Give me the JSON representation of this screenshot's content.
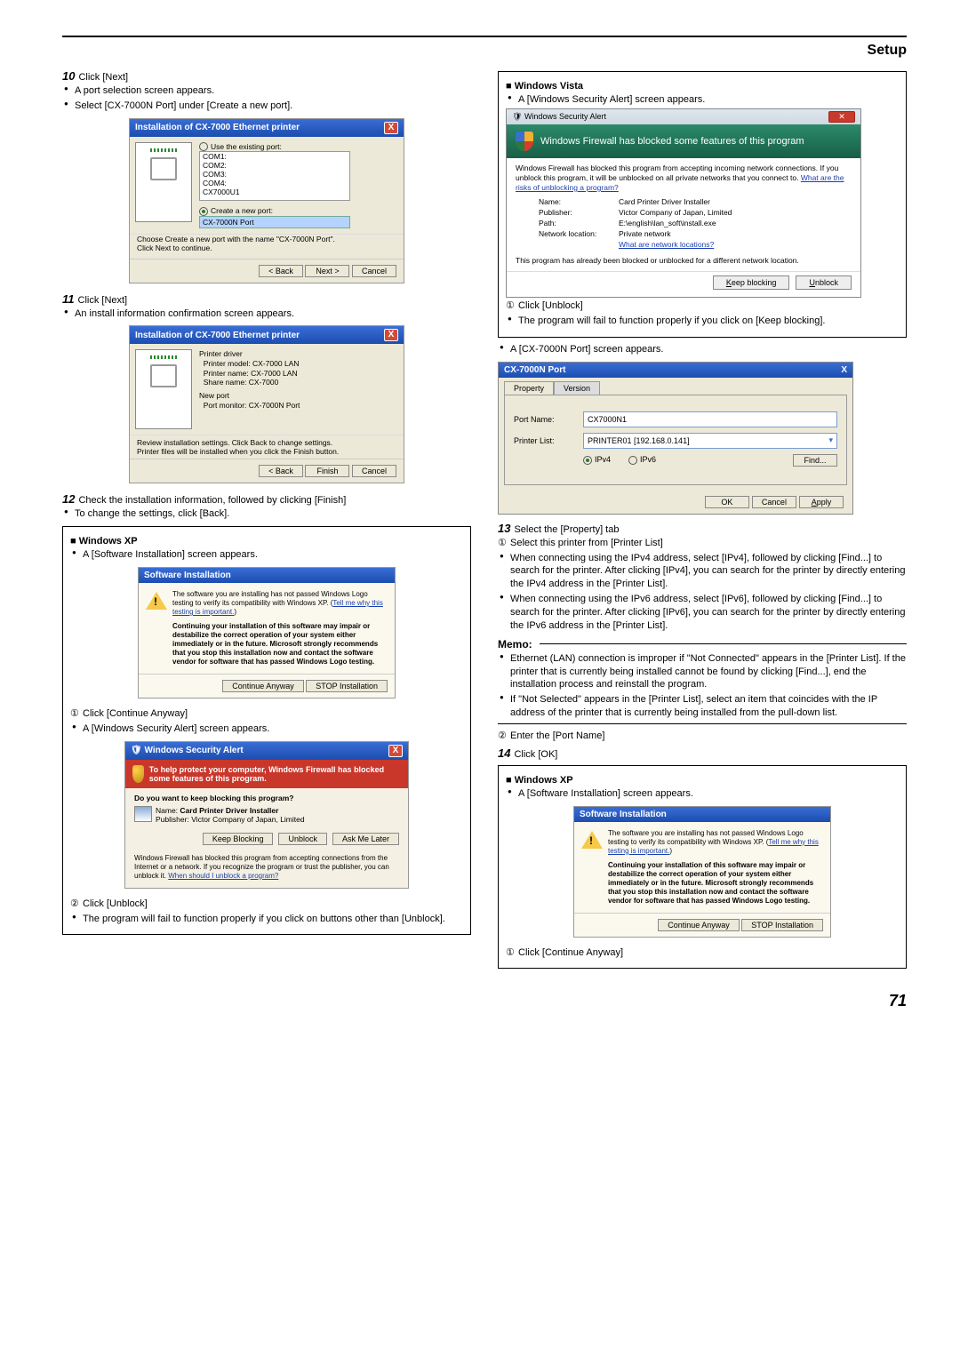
{
  "header": {
    "title": "Setup"
  },
  "page_number": "71",
  "steps": {
    "s10": {
      "num": "10",
      "text": "Click [Next]",
      "b1": "A port selection screen appears.",
      "b2": "Select [CX-7000N Port] under [Create a new port]."
    },
    "s11": {
      "num": "11",
      "text": "Click [Next]",
      "b1": "An install information confirmation screen appears."
    },
    "s12": {
      "num": "12",
      "text": "Check the installation information, followed by clicking [Finish]",
      "b1": "To change the settings, click [Back]."
    },
    "s13": {
      "num": "13",
      "text": "Select the [Property] tab"
    },
    "s14": {
      "num": "14",
      "text": "Click [OK]"
    }
  },
  "xp1": {
    "head": "Windows XP",
    "b1": "A [Software Installation] screen appears.",
    "c1": "Click [Continue Anyway]",
    "b2": "A [Windows Security Alert] screen appears.",
    "c2": "Click [Unblock]",
    "b3": "The program will fail to function properly if you click on buttons other than [Unblock]."
  },
  "vista": {
    "head": "Windows Vista",
    "b1": "A [Windows Security Alert] screen appears.",
    "c1": "Click [Unblock]",
    "b2": "The program will fail to function properly if you click on [Keep blocking].",
    "b3": "A [CX-7000N Port] screen appears."
  },
  "prop": {
    "c1": "Select this printer from [Printer List]",
    "b1": "When connecting using the IPv4 address, select [IPv4], followed by clicking [Find...] to search for the printer. After clicking [IPv4], you can search for the printer by directly entering the IPv4 address in the [Printer List].",
    "b2": "When connecting using the IPv6 address, select [IPv6], followed by clicking [Find...] to search for the printer. After clicking [IPv6], you can search for the printer by directly entering the IPv6 address in the [Printer List].",
    "memo_label": "Memo:",
    "m1": "Ethernet (LAN) connection is improper if \"Not Connected\" appears in the [Printer List]. If the printer that is currently being installed cannot be found by clicking [Find...], end the installation process and reinstall the program.",
    "m2": "If \"Not Selected\" appears in the [Printer List], select an item that coincides with the IP address of the printer that is currently being installed from the pull-down list.",
    "c2": "Enter the [Port Name]"
  },
  "xp2": {
    "head": "Windows XP",
    "b1": "A [Software Installation] screen appears.",
    "c1": "Click [Continue Anyway]"
  },
  "dlg1": {
    "title": "Installation of CX-7000 Ethernet printer",
    "use_existing": "Use the existing port:",
    "ports": "COM1:\nCOM2:\nCOM3:\nCOM4:\nCX7000U1",
    "create_new": "Create a new port:",
    "new_port_value": "CX-7000N Port",
    "instr": "Choose Create a new port with the name \"CX-7000N Port\".\nClick Next to continue.",
    "back": "< Back",
    "next": "Next >",
    "cancel": "Cancel"
  },
  "dlg2": {
    "title": "Installation of CX-7000 Ethernet printer",
    "pd": "Printer driver",
    "pm": "Printer model:",
    "pm_v": "CX-7000 LAN",
    "pn": "Printer name:",
    "pn_v": "CX-7000 LAN",
    "sn": "Share name:",
    "sn_v": "CX-7000",
    "np": "New port",
    "pmon": "Port monitor:",
    "pmon_v": "CX-7000N Port",
    "review": "Review installation settings. Click Back to change settings.\nPrinter files will be installed when you click the Finish button.",
    "back": "< Back",
    "finish": "Finish",
    "cancel": "Cancel"
  },
  "dlg3": {
    "title": "Software Installation",
    "l1": "The software you are installing has not passed Windows Logo testing to verify its compatibility with Windows XP. (",
    "link1": "Tell me why this testing is important.",
    "l1b": ")",
    "l2": "Continuing your installation of this software may impair or destabilize the correct operation of your system either immediately or in the future. Microsoft strongly recommends that you stop this installation now and contact the software vendor for software that has passed Windows Logo testing.",
    "cont": "Continue Anyway",
    "stop": "STOP Installation"
  },
  "dlg4": {
    "title": "Windows Security Alert",
    "banner": "To help protect your computer, Windows Firewall has blocked some features of this program.",
    "q": "Do you want to keep blocking this program?",
    "name_l": "Name:",
    "name_v": "Card Printer Driver Installer",
    "pub_l": "Publisher:",
    "pub_v": "Victor Company of Japan, Limited",
    "keep": "Keep Blocking",
    "unblock": "Unblock",
    "ask": "Ask Me Later",
    "exp1": "Windows Firewall has blocked this program from accepting connections from the Internet or a network. If you recognize the program or trust the publisher, you can unblock it. ",
    "explink": "When should I unblock a program?"
  },
  "dlg5": {
    "wtitle": "Windows Security Alert",
    "banner": "Windows Firewall has blocked some features of this program",
    "l1a": "Windows Firewall has blocked this program from accepting incoming network connections. If you unblock this program, it will be unblocked on all private networks that you connect to. ",
    "link1": "What are the risks of unblocking a program?",
    "name_l": "Name:",
    "name_v": "Card Printer Driver Installer",
    "pub_l": "Publisher:",
    "pub_v": "Victor Company of Japan, Limited",
    "path_l": "Path:",
    "path_v": "E:\\english\\lan_soft\\install.exe",
    "net_l": "Network location:",
    "net_v": "Private network",
    "link2": "What are network locations?",
    "note": "This program has already been blocked or unblocked for a different network location.",
    "keep": "Keep blocking",
    "unblock": "Unblock"
  },
  "dlg6": {
    "title": "CX-7000N Port",
    "tab1": "Property",
    "tab2": "Version",
    "portname_l": "Port Name:",
    "portname_v": "CX7000N1",
    "plist_l": "Printer List:",
    "plist_v": "PRINTER01 [192.168.0.141]",
    "ipv4": "IPv4",
    "ipv6": "IPv6",
    "find": "Find...",
    "ok": "OK",
    "cancel": "Cancel",
    "apply": "Apply"
  }
}
